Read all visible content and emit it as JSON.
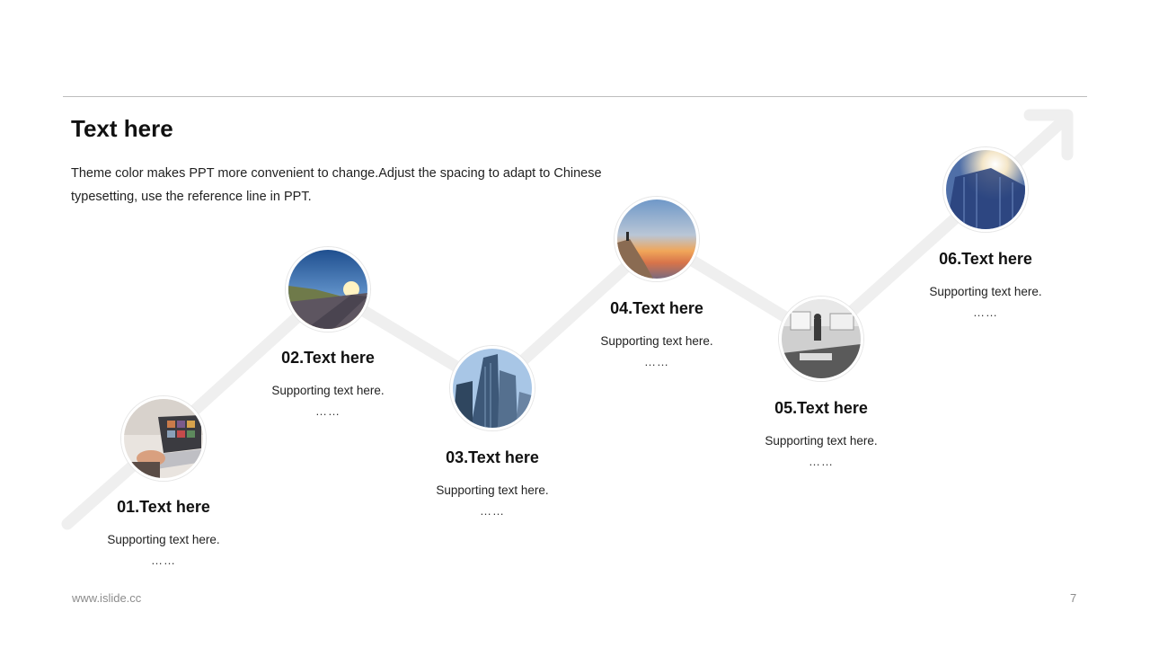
{
  "slide": {
    "title": "Text here",
    "description": "Theme color makes PPT more convenient to change.Adjust the spacing to adapt to Chinese typesetting, use the reference line in PPT."
  },
  "steps": [
    {
      "title": "01.Text here",
      "text": "Supporting text here.",
      "dots": "……",
      "photo": "laptop-photo"
    },
    {
      "title": "02.Text here",
      "text": "Supporting text here.",
      "dots": "……",
      "photo": "road-sunset-photo"
    },
    {
      "title": "03.Text here",
      "text": "Supporting text here.",
      "dots": "……",
      "photo": "skyscraper-photo"
    },
    {
      "title": "04.Text here",
      "text": "Supporting text here.",
      "dots": "……",
      "photo": "cliff-sunset-photo"
    },
    {
      "title": "05.Text here",
      "text": "Supporting text here.",
      "dots": "……",
      "photo": "office-meeting-photo"
    },
    {
      "title": "06.Text here",
      "text": "Supporting text here.",
      "dots": "……",
      "photo": "glass-tower-photo"
    }
  ],
  "footer": {
    "url": "www.islide.cc",
    "page": "7"
  },
  "colors": {
    "path": "#efefef",
    "text": "#111111",
    "muted": "#8c8c8c"
  }
}
